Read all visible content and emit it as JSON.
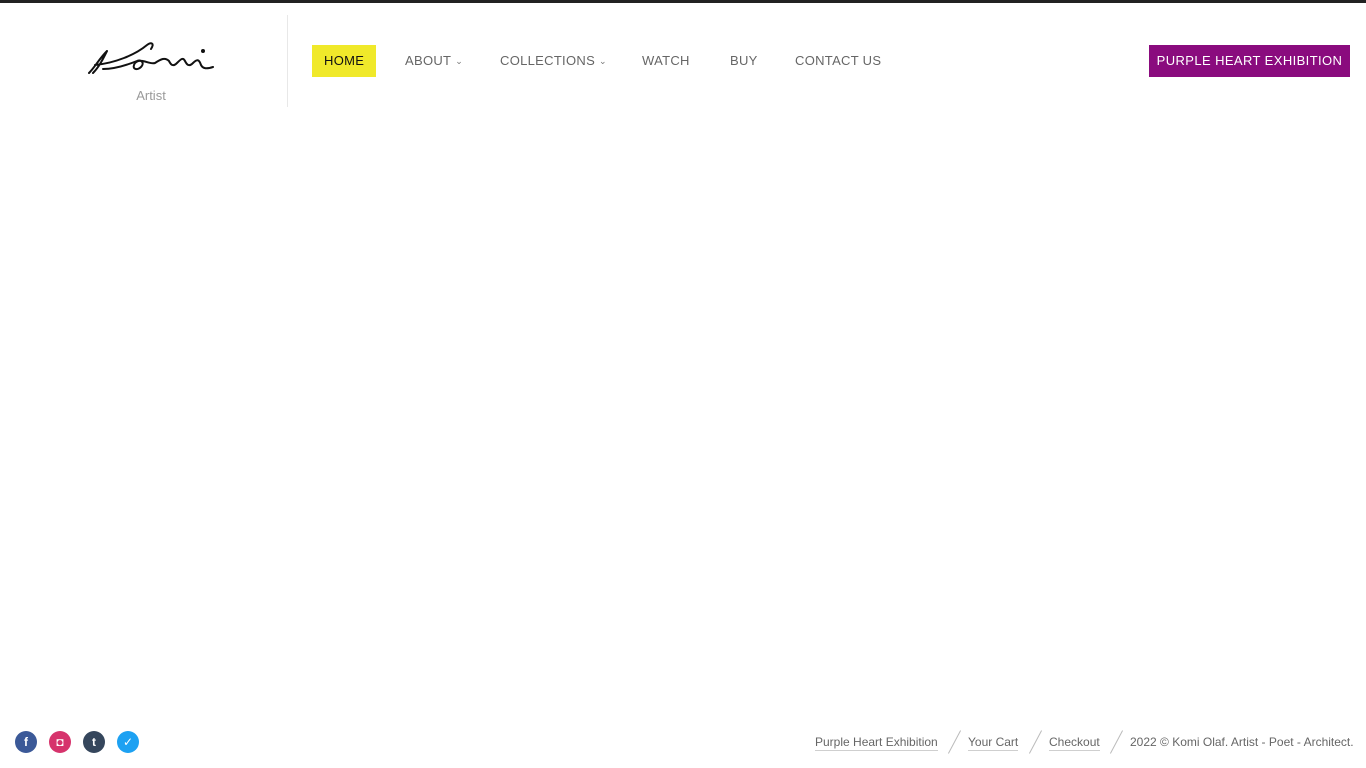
{
  "brand": {
    "logo_text": "Komi",
    "tagline": "Artist"
  },
  "nav": {
    "items": [
      {
        "label": "HOME",
        "active": true,
        "has_dropdown": false
      },
      {
        "label": "ABOUT",
        "active": false,
        "has_dropdown": true
      },
      {
        "label": "COLLECTIONS",
        "active": false,
        "has_dropdown": true
      },
      {
        "label": "WATCH",
        "active": false,
        "has_dropdown": false
      },
      {
        "label": "BUY",
        "active": false,
        "has_dropdown": false
      },
      {
        "label": "CONTACT US",
        "active": false,
        "has_dropdown": false
      }
    ],
    "cta_label": "PURPLE HEART EXHIBITION"
  },
  "social": [
    {
      "icon": "facebook-icon",
      "glyph": "f",
      "color": "#3b5998"
    },
    {
      "icon": "instagram-icon",
      "glyph": "◘",
      "color": "#d6336c"
    },
    {
      "icon": "tumblr-icon",
      "glyph": "t",
      "color": "#35465c"
    },
    {
      "icon": "twitter-icon",
      "glyph": "✓",
      "color": "#1da1f2"
    }
  ],
  "footer": {
    "links": [
      "Purple Heart Exhibition",
      "Your Cart",
      "Checkout"
    ],
    "copyright": "2022 © Komi Olaf. Artist - Poet - Architect."
  },
  "colors": {
    "active_nav_bg": "#f0e92a",
    "cta_bg": "#8a0b7e"
  }
}
